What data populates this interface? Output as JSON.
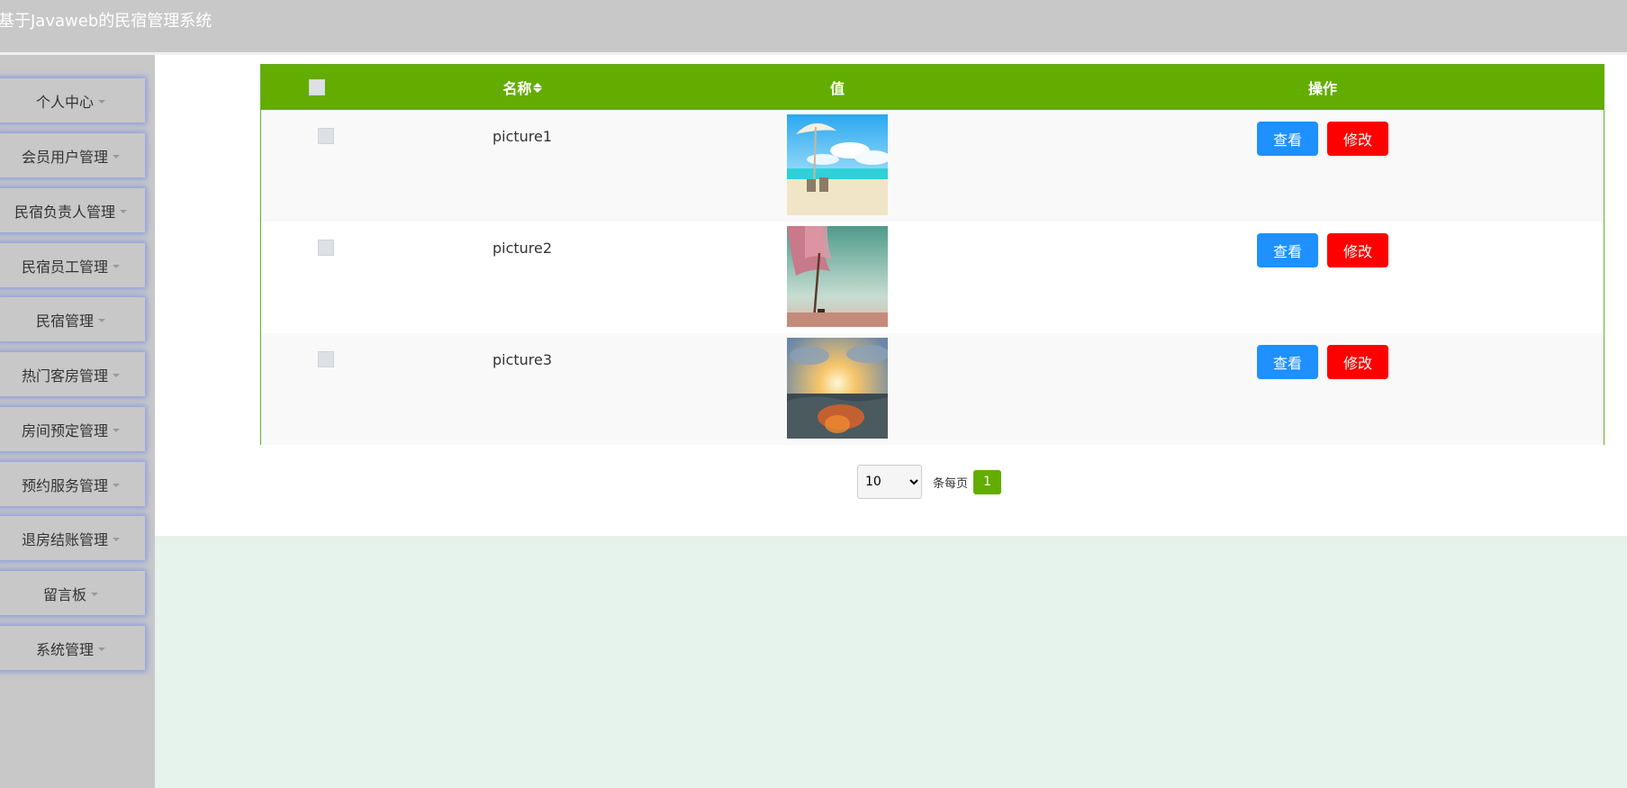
{
  "header": {
    "title": "基于Javaweb的民宿管理系统"
  },
  "sidebar": {
    "items": [
      {
        "label": "个人中心"
      },
      {
        "label": "会员用户管理"
      },
      {
        "label": "民宿负责人管理"
      },
      {
        "label": "民宿员工管理"
      },
      {
        "label": "民宿管理"
      },
      {
        "label": "热门客房管理"
      },
      {
        "label": "房间预定管理"
      },
      {
        "label": "预约服务管理"
      },
      {
        "label": "退房结账管理"
      },
      {
        "label": "留言板"
      },
      {
        "label": "系统管理"
      }
    ]
  },
  "table": {
    "columns": {
      "name": "名称",
      "value": "值",
      "actions": "操作"
    },
    "rows": [
      {
        "name": "picture1",
        "view_label": "查看",
        "edit_label": "修改"
      },
      {
        "name": "picture2",
        "view_label": "查看",
        "edit_label": "修改"
      },
      {
        "name": "picture3",
        "view_label": "查看",
        "edit_label": "修改"
      }
    ]
  },
  "pagination": {
    "page_size": "10",
    "page_size_options": [
      "10"
    ],
    "per_page_label": "条每页",
    "current_page": "1"
  },
  "colors": {
    "header_bg": "#c8c8c8",
    "table_header_bg": "#63ad00",
    "view_button": "#1e90ff",
    "edit_button": "#ff0000"
  }
}
